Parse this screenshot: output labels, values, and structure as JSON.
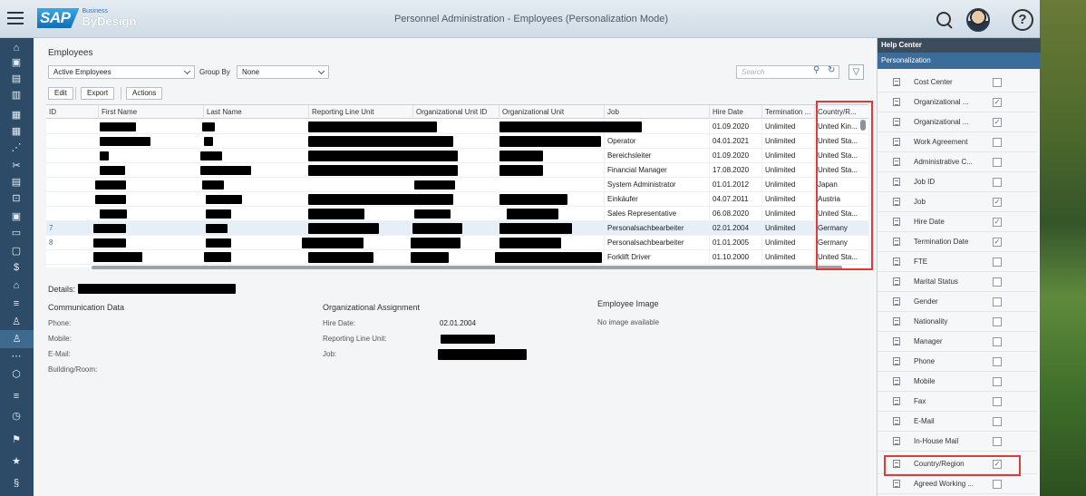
{
  "header": {
    "brand_sap": "SAP",
    "brand_business": "Business",
    "brand_bydesign": "ByDesign",
    "title": "Personnel Administration - Employees (Personalization Mode)"
  },
  "main": {
    "section_title": "Employees",
    "filter": {
      "value": "Active Employees",
      "group_by_label": "Group By",
      "group_by_value": "None"
    },
    "search_placeholder": "Search",
    "toolbar": {
      "edit": "Edit",
      "export": "Export",
      "actions": "Actions"
    },
    "table": {
      "columns": [
        "ID",
        "First Name",
        "Last Name",
        "Reporting Line Unit",
        "Organizational Unit ID",
        "Organizational Unit",
        "Job",
        "Hire Date",
        "Termination ...",
        "Country/R..."
      ],
      "rows": [
        {
          "id": "",
          "job": "",
          "hire": "01.09.2020",
          "term": "Unlimited",
          "country": "United Kin..."
        },
        {
          "id": "",
          "job": "Operator",
          "hire": "04.01.2021",
          "term": "Unlimited",
          "country": "United Sta..."
        },
        {
          "id": "",
          "job": "Bereichsleiter",
          "hire": "01.09.2020",
          "term": "Unlimited",
          "country": "United Sta..."
        },
        {
          "id": "",
          "job": "Financial Manager",
          "hire": "17.08.2020",
          "term": "Unlimited",
          "country": "United Sta..."
        },
        {
          "id": "",
          "job": "System Administrator",
          "hire": "01.01.2012",
          "term": "Unlimited",
          "country": "Japan"
        },
        {
          "id": "",
          "job": "Einkäufer",
          "hire": "04.07.2011",
          "term": "Unlimited",
          "country": "Austria"
        },
        {
          "id": "",
          "job": "Sales Representative",
          "hire": "06.08.2020",
          "term": "Unlimited",
          "country": "United Sta..."
        },
        {
          "id": "7",
          "job": "Personalsachbearbeiter",
          "hire": "02.01.2004",
          "term": "Unlimited",
          "country": "Germany"
        },
        {
          "id": "8",
          "job": "Personalsachbearbeiter",
          "hire": "01.01.2005",
          "term": "Unlimited",
          "country": "Germany"
        },
        {
          "id": "",
          "job": "Forklift Driver",
          "hire": "01.10.2000",
          "term": "Unlimited",
          "country": "United Sta..."
        }
      ]
    },
    "details": {
      "label": "Details:",
      "communication": {
        "title": "Communication Data",
        "phone": "Phone:",
        "mobile": "Mobile:",
        "email": "E-Mail:",
        "building": "Building/Room:"
      },
      "org": {
        "title": "Organizational Assignment",
        "hire_label": "Hire Date:",
        "hire_value": "02.01.2004",
        "rlu_label": "Reporting Line Unit:",
        "job_label": "Job:"
      },
      "image": {
        "title": "Employee Image",
        "none": "No image available"
      }
    }
  },
  "rightpanel": {
    "help_center": "Help Center",
    "personalization": "Personalization",
    "items": [
      {
        "label": "Cost Center",
        "checked": false
      },
      {
        "label": "Organizational ...",
        "checked": true
      },
      {
        "label": "Organizational ...",
        "checked": true
      },
      {
        "label": "Work Agreement",
        "checked": false
      },
      {
        "label": "Administrative C...",
        "checked": false
      },
      {
        "label": "Job ID",
        "checked": false
      },
      {
        "label": "Job",
        "checked": true
      },
      {
        "label": "Hire Date",
        "checked": true
      },
      {
        "label": "Termination Date",
        "checked": true
      },
      {
        "label": "FTE",
        "checked": false
      },
      {
        "label": "Marital Status",
        "checked": false
      },
      {
        "label": "Gender",
        "checked": false
      },
      {
        "label": "Nationality",
        "checked": false
      },
      {
        "label": "Manager",
        "checked": false
      },
      {
        "label": "Phone",
        "checked": false
      },
      {
        "label": "Mobile",
        "checked": false
      },
      {
        "label": "Fax",
        "checked": false
      },
      {
        "label": "E-Mail",
        "checked": false
      },
      {
        "label": "In-House Mail",
        "checked": false
      },
      {
        "label": "Country/Region",
        "checked": true
      },
      {
        "label": "Agreed Working ...",
        "checked": false
      }
    ]
  },
  "colors": {
    "nav": "#2d4b66",
    "accent": "#3a6c9c",
    "highlight": "#e03a3a"
  }
}
